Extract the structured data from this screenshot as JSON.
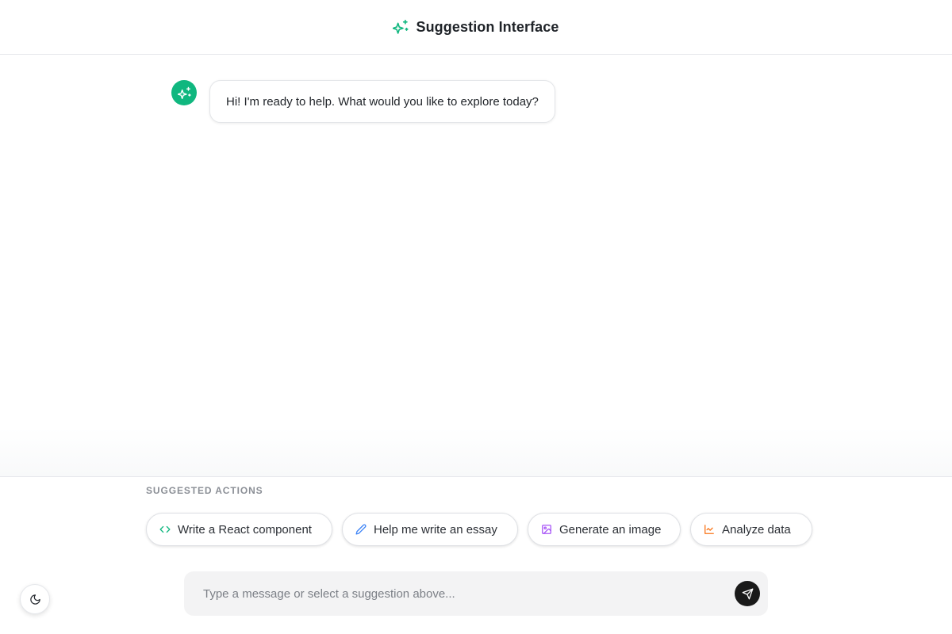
{
  "header": {
    "title": "Suggestion Interface",
    "icon": "sparkles-icon",
    "accent_color": "#10b77f"
  },
  "chat": {
    "messages": [
      {
        "role": "assistant",
        "avatar_icon": "sparkles-icon",
        "text": "Hi! I'm ready to help. What would you like to explore today?"
      }
    ]
  },
  "suggestions": {
    "label": "SUGGESTED ACTIONS",
    "items": [
      {
        "label": "Write a React component",
        "icon": "code-icon",
        "color": "#10b77f"
      },
      {
        "label": "Help me write an essay",
        "icon": "pencil-icon",
        "color": "#3b82f6"
      },
      {
        "label": "Generate an image",
        "icon": "image-icon",
        "color": "#a855f7"
      },
      {
        "label": "Analyze data",
        "icon": "chart-line-icon",
        "color": "#f97316"
      }
    ]
  },
  "composer": {
    "placeholder": "Type a message or select a suggestion above...",
    "value": "",
    "send_icon": "send-icon"
  },
  "theme_toggle": {
    "icon": "moon-icon"
  }
}
